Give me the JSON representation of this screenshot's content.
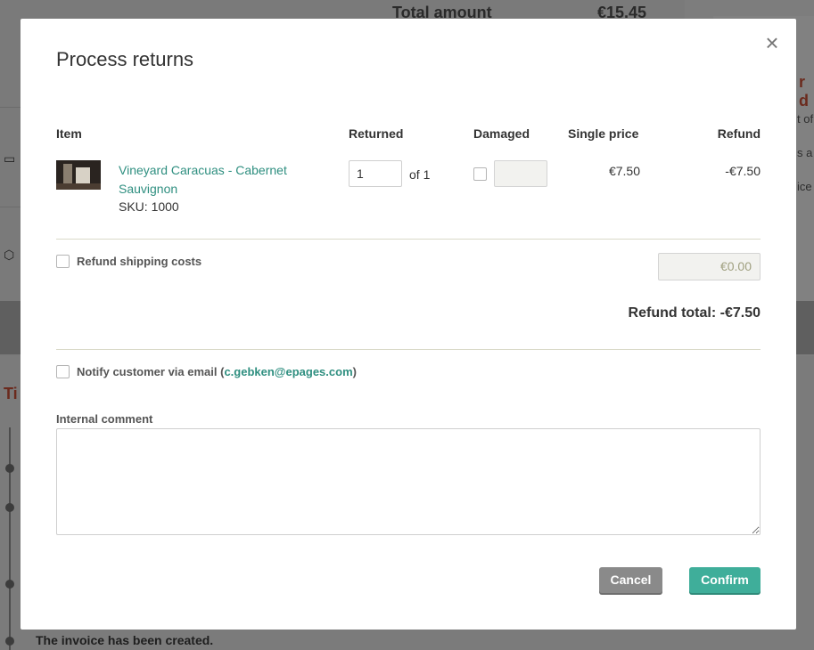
{
  "background": {
    "total_label": "Total amount",
    "total_value": "€15.45",
    "timeline_title": "Ti",
    "right_heading": "r d",
    "right_texts": [
      "t of",
      "s a",
      "ice"
    ],
    "invoice_text": "The invoice has been created."
  },
  "modal": {
    "title": "Process returns",
    "close_icon": "close-icon",
    "columns": {
      "item": "Item",
      "returned": "Returned",
      "damaged": "Damaged",
      "single_price": "Single price",
      "refund": "Refund"
    },
    "line_item": {
      "name": "Vineyard Caracuas - Cabernet Sauvignon",
      "sku": "SKU: 1000",
      "returned_value": "1",
      "of_label": "of 1",
      "damaged_value": "",
      "single_price": "€7.50",
      "refund": "-€7.50"
    },
    "shipping": {
      "label": "Refund shipping costs",
      "value": "€0.00"
    },
    "refund_total": "Refund total: -€7.50",
    "notify": {
      "label_prefix": "Notify customer via email (",
      "email": "c.gebken@epages.com",
      "label_suffix": ")"
    },
    "comment": {
      "label": "Internal comment",
      "value": ""
    },
    "buttons": {
      "cancel": "Cancel",
      "confirm": "Confirm"
    }
  },
  "colors": {
    "accent": "#3fae9a",
    "link": "#2f8f80",
    "cancel": "#8a8a8a"
  }
}
